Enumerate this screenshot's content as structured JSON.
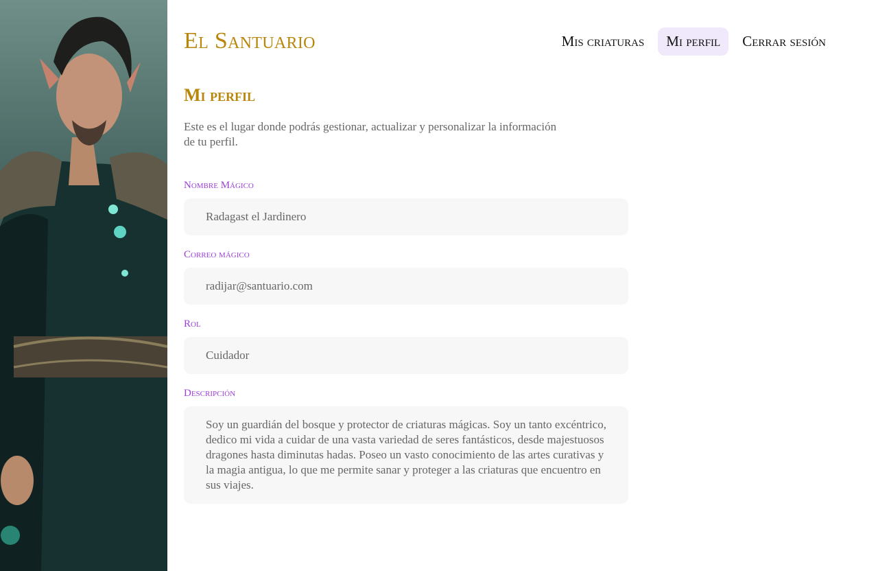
{
  "app": {
    "brand": "El Santuario"
  },
  "nav": {
    "items": [
      {
        "label": "Mis criaturas",
        "active": false
      },
      {
        "label": "Mi perfil",
        "active": true
      },
      {
        "label": "Cerrar sesión",
        "active": false
      }
    ]
  },
  "profile": {
    "title": "Mi perfil",
    "intro": "Este es el lugar donde podrás gestionar, actualizar y personalizar la información de tu perfil.",
    "fields": {
      "name": {
        "label": "Nombre Mágico",
        "value": "Radagast el Jardinero"
      },
      "email": {
        "label": "Correo mágico",
        "value": "radijar@santuario.com"
      },
      "role": {
        "label": "Rol",
        "value": "Cuidador"
      },
      "description": {
        "label": "Descripción",
        "value": "Soy un guardián del bosque y protector de criaturas mágicas. Soy un tanto excéntrico, dedico mi vida a cuidar de una vasta variedad de seres fantásticos, desde majestuosos dragones hasta diminutas hadas. Poseo un vasto conocimiento de las artes curativas y la magia antigua, lo que me permite sanar y proteger a las criaturas que encuentro en sus viajes."
      }
    }
  },
  "colors": {
    "brand": "#b8860b",
    "label": "#9b40d6",
    "active_nav_bg": "#f0e8fb",
    "field_bg": "#f7f7f7"
  }
}
